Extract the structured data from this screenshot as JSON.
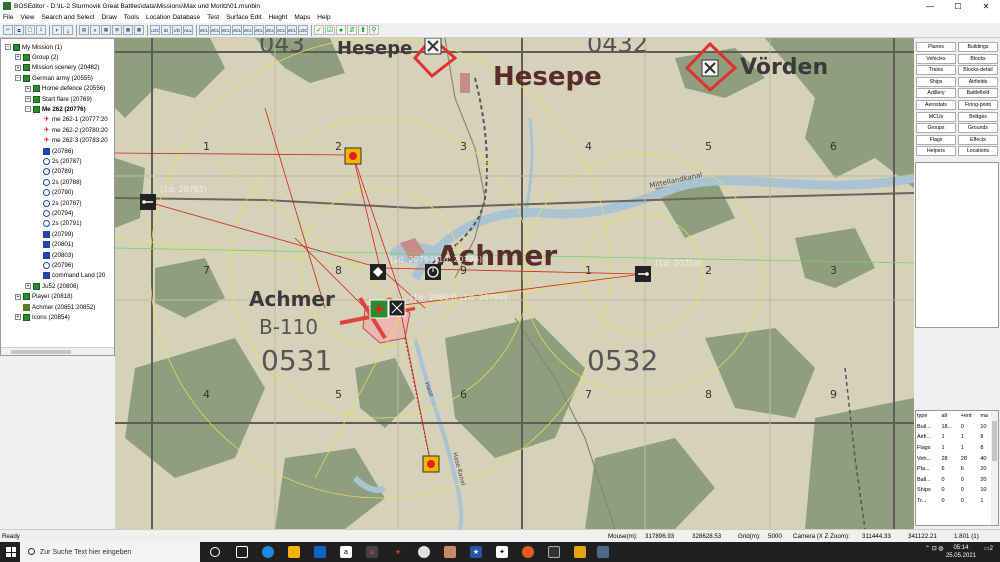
{
  "window": {
    "title": "BOSEditor - D:\\IL-2 Sturmovik Great Battles\\data\\Missions\\Max und Moritz\\01.msnbin",
    "minimize": "—",
    "maximize": "☐",
    "close": "✕"
  },
  "menu": [
    "File",
    "View",
    "Search and Select",
    "Draw",
    "Tools",
    "Location Database",
    "Test",
    "Surface Edit",
    "Height",
    "Maps",
    "Help"
  ],
  "toolbar": {
    "buttons": [
      "✂",
      "⧉",
      "📋",
      "⇩",
      "F",
      "⤓",
      "▤",
      "#",
      "▦",
      "⊞",
      "▩",
      "▦",
      "LOC",
      "ID",
      "I/D",
      "ALL",
      "MCU",
      "MCU",
      "MCU",
      "MCU",
      "MCU",
      "MCU",
      "MCU",
      "MCU",
      "MCU",
      "LOC"
    ],
    "extra": [
      "✓",
      "☑",
      "●",
      "⇵",
      "⬆",
      "⚲"
    ]
  },
  "tree": {
    "items": [
      {
        "label": "My Mission (1)",
        "indent": 0,
        "icon": "group",
        "expander": "−"
      },
      {
        "label": "Group (2)",
        "indent": 1,
        "icon": "group",
        "expander": "+"
      },
      {
        "label": "Mission scenery (20482)",
        "indent": 1,
        "icon": "group",
        "expander": "+"
      },
      {
        "label": "German army (20555)",
        "indent": 1,
        "icon": "group",
        "expander": "−"
      },
      {
        "label": "Home defence (20556)",
        "indent": 2,
        "icon": "group",
        "expander": "+"
      },
      {
        "label": "Start flare (20769)",
        "indent": 2,
        "icon": "group",
        "expander": "+"
      },
      {
        "label": "Me 262 (20776)",
        "indent": 2,
        "icon": "group",
        "expander": "−",
        "bold": true
      },
      {
        "label": "me 262-1 (20777:20",
        "indent": 3,
        "icon": "plane"
      },
      {
        "label": "me 262-2 (20780:20",
        "indent": 3,
        "icon": "plane"
      },
      {
        "label": "me 262-3 (20783:20",
        "indent": 3,
        "icon": "plane"
      },
      {
        "label": "(20786)",
        "indent": 3,
        "icon": "mcu"
      },
      {
        "label": "2s (20787)",
        "indent": 3,
        "icon": "clock"
      },
      {
        "label": "(20789)",
        "indent": 3,
        "icon": "clock"
      },
      {
        "label": "2s (20788)",
        "indent": 3,
        "icon": "clock"
      },
      {
        "label": "(20790)",
        "indent": 3,
        "icon": "clock"
      },
      {
        "label": "2s (20787)",
        "indent": 3,
        "icon": "clock"
      },
      {
        "label": "(20794)",
        "indent": 3,
        "icon": "clock"
      },
      {
        "label": "2s (20791)",
        "indent": 3,
        "icon": "clock"
      },
      {
        "label": "(20799)",
        "indent": 3,
        "icon": "mcu"
      },
      {
        "label": "(20801)",
        "indent": 3,
        "icon": "mcu"
      },
      {
        "label": "(20803)",
        "indent": 3,
        "icon": "mcu"
      },
      {
        "label": "(20796)",
        "indent": 3,
        "icon": "clock"
      },
      {
        "label": "command Land (20",
        "indent": 3,
        "icon": "mcu"
      },
      {
        "label": "Ju52 (20806)",
        "indent": 2,
        "icon": "group",
        "expander": "+"
      },
      {
        "label": "Player (20818)",
        "indent": 1,
        "icon": "group",
        "expander": "+"
      },
      {
        "label": "Achmer (20851:20852)",
        "indent": 1,
        "icon": "flag"
      },
      {
        "label": "Icons (20854)",
        "indent": 1,
        "icon": "group",
        "expander": "+"
      }
    ]
  },
  "map": {
    "labels": {
      "hesepe_top": "Hesepe",
      "hesepe": "Hesepe",
      "vorden": "Vörden",
      "achmer_main": "Achmer",
      "achmer_west": "Achmer",
      "b110": "B-110",
      "grid_0531": "0531",
      "grid_0532": "0532",
      "grid_0432": "0432",
      "grid_0431": "043",
      "canal": "Mittellandkanal",
      "river": "Hase",
      "canal2": "Hase-Kanal"
    },
    "grid_digits": [
      "1",
      "2",
      "3",
      "4",
      "5",
      "6",
      "7",
      "8",
      "9",
      "1",
      "2",
      "3",
      "4",
      "5",
      "6",
      "7",
      "8",
      "9",
      "1",
      "2",
      "3",
      "4",
      "5",
      "6",
      "7",
      "8",
      "9"
    ],
    "object_ids": [
      "(1d: 20765)",
      "(1d: 20794)",
      "(1d: 20796)",
      "(1d: 20750)",
      "(1d: 20803)",
      "(1d: 20796)"
    ]
  },
  "object_buttons": [
    [
      "Planes",
      "Buildings"
    ],
    [
      "Vehicles",
      "Blocks"
    ],
    [
      "Trains",
      "Blocks-detail"
    ],
    [
      "Ships",
      "Airfields"
    ],
    [
      "Artillery",
      "Battlefield"
    ],
    [
      "Aerostats",
      "Firing-point"
    ],
    [
      "MCUs",
      "Bridges"
    ],
    [
      "Groups",
      "Grounds"
    ],
    [
      "Flags",
      "Effects"
    ],
    [
      "Helpers",
      "Locations"
    ]
  ],
  "stats": {
    "headers": [
      "type",
      "all",
      "+ent",
      "ma"
    ],
    "rows": [
      [
        "Buil...",
        "18...",
        "0",
        "10"
      ],
      [
        "Airfi...",
        "1",
        "1",
        "8"
      ],
      [
        "Flags",
        "1",
        "1",
        "8"
      ],
      [
        "Veh...",
        "28",
        "28",
        "40"
      ],
      [
        "Pla...",
        "6",
        "6",
        "20"
      ],
      [
        "Ball...",
        "0",
        "0",
        "20"
      ],
      [
        "Ships",
        "0",
        "0",
        "10"
      ],
      [
        "Tr...",
        "0",
        "0",
        "1"
      ]
    ]
  },
  "status": {
    "ready": "Ready",
    "mouse_label": "Mouse(m):",
    "mouse_x": "317896.93",
    "mouse_z": "328628.53",
    "grid_label": "Grid(m):",
    "grid": "5000",
    "camera_label": "Camera (X  Z  Zoom):",
    "cam_x": "311444.33",
    "cam_z": "341122.21",
    "cam_zoom": "1.801 (1)"
  },
  "taskbar": {
    "search_placeholder": "Zur Suche Text hier eingeben",
    "time": "05:14",
    "date": "25.05.2021",
    "notif": "2"
  },
  "colors": {
    "map_land": "#d6d2ba",
    "forest": "#8f9f7d",
    "water": "#a9c3d2",
    "grid": "#5e5e55",
    "red_line": "#d22020",
    "yellow_line": "#e8e35a"
  }
}
